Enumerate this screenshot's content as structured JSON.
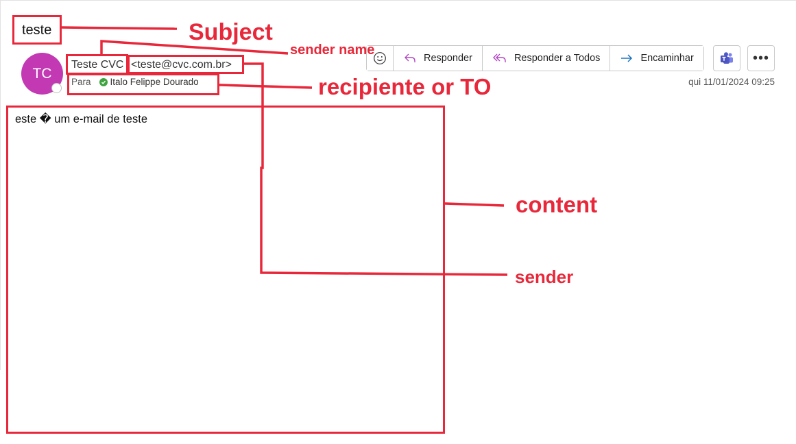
{
  "email": {
    "subject": "teste",
    "avatar_initials": "TC",
    "sender_name": "Teste CVC",
    "sender_email": "<teste@cvc.com.br>",
    "to_label": "Para",
    "recipient": "Italo Felippe Dourado",
    "date": "qui 11/01/2024 09:25",
    "body": "este � um e-mail de teste"
  },
  "toolbar": {
    "emoji_icon": "smiley-icon",
    "reply_label": "Responder",
    "reply_all_label": "Responder a Todos",
    "forward_label": "Encaminhar",
    "teams_icon": "teams-icon",
    "more_icon": "more-icon"
  },
  "annotations": {
    "subject": "Subject",
    "sender_name": "sender name",
    "recipient": "recipiente or TO",
    "content": "content",
    "sender": "sender"
  },
  "colors": {
    "annotation": "#e8283a",
    "avatar": "#c239b3",
    "presence_ok": "#3fa33f",
    "reply_icon": "#b146c2",
    "forward_icon": "#0f6cbd"
  }
}
